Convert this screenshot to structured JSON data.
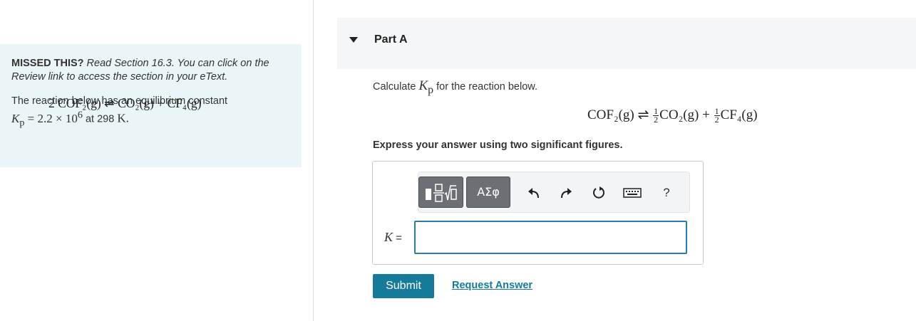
{
  "hint": {
    "missed_label": "MISSED THIS?",
    "missed_text": " Read Section 16.3. You can click on the Review link to access the section in your eText.",
    "intro": "The reaction below has an equilibrium constant",
    "kp_symbol": "K",
    "kp_sub": "p",
    "kp_value": " = 2.2 × 10",
    "kp_exp": "6",
    "temp_text": " at 298 ",
    "temp_unit": "K.",
    "equation": "2 COF₂(g) ⇌ CO₂(g) + CF₄(g)"
  },
  "part": {
    "title": "Part A"
  },
  "question": {
    "prefix": "Calculate ",
    "k_symbol": "K",
    "k_sub": "p",
    "suffix": " for the reaction below.",
    "reaction_left": "COF₂(g) ⇌ ",
    "half_num": "1",
    "half_den": "2",
    "reaction_mid": "CO₂(g) + ",
    "reaction_right": "CF₄(g)",
    "instruction": "Express your answer using two significant figures."
  },
  "toolbar": {
    "greek_label": "ΑΣφ",
    "help_label": "?",
    "icons": [
      "templates-icon",
      "greek-letters-icon",
      "undo-icon",
      "redo-icon",
      "reset-icon",
      "keyboard-icon",
      "help-icon"
    ]
  },
  "answer": {
    "label_symbol": "K",
    "label_eq": " =",
    "value": ""
  },
  "actions": {
    "submit_label": "Submit",
    "request_label": "Request Answer"
  },
  "colors": {
    "accent": "#157b9b",
    "input_border": "#2a7bb3",
    "hint_bg": "#e9f5f6"
  }
}
